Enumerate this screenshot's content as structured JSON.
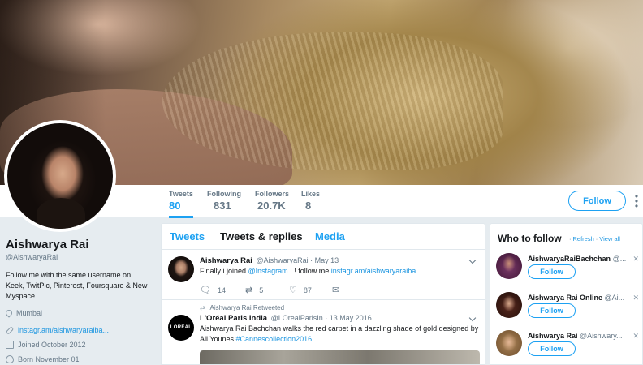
{
  "profile": {
    "name": "Aishwarya Rai",
    "handle": "@AishwaryaRai",
    "bio": "Follow me with the same username on Keek, TwitPic, Pinterest, Foursquare & New Myspace.",
    "location": "Mumbai",
    "website": "instagr.am/aishwaryaraiba...",
    "joined": "Joined October 2012",
    "birthday": "Born November 01"
  },
  "stats": [
    {
      "label": "Tweets",
      "value": "80"
    },
    {
      "label": "Following",
      "value": "831"
    },
    {
      "label": "Followers",
      "value": "20.7K"
    },
    {
      "label": "Likes",
      "value": "8"
    }
  ],
  "follow_button": "Follow",
  "tabs": {
    "tweets": "Tweets",
    "replies": "Tweets & replies",
    "media": "Media"
  },
  "tweets": [
    {
      "name": "Aishwarya Rai",
      "handle": "@AishwaryaRai",
      "date": "· May 13",
      "text_pre": "Finally i joined ",
      "mention": "@Instagram",
      "text_mid": "...! follow me ",
      "link": "instagr.am/aishwaryaraiba...",
      "replies": "14",
      "retweets": "5",
      "likes": "87"
    },
    {
      "retweet_note": "Aishwarya Rai Retweeted",
      "name": "L'Oréal Paris India",
      "handle": "@LOrealParisIn",
      "date": "· 13 May 2016",
      "text_pre": "Aishwarya Rai Bachchan walks the red carpet in a dazzling shade of gold designed by Ali Younes ",
      "hashtag": "#Cannescollection2016",
      "avatar_text": "LORÉAL"
    }
  ],
  "who_to_follow": {
    "title": "Who to follow",
    "refresh": "Refresh",
    "view_all": "View all",
    "suggestions": [
      {
        "name": "AishwaryaRaiBachchan",
        "handle": "@...",
        "button": "Follow"
      },
      {
        "name": "Aishwarya Rai Online",
        "handle": "@Ai...",
        "button": "Follow"
      },
      {
        "name": "Aishwarya Rai",
        "handle": "@Aishwary...",
        "button": "Follow"
      }
    ]
  },
  "icons": {
    "location": "map-pin-icon",
    "website": "link-icon",
    "joined": "calendar-icon",
    "birthday": "balloon-icon",
    "reply": "reply-icon",
    "retweet": "retweet-icon",
    "like": "heart-icon",
    "message": "envelope-icon"
  },
  "colors": {
    "accent": "#1da1f2",
    "link": "#1b95e0",
    "muted": "#657786",
    "background": "#e6ecf0"
  }
}
